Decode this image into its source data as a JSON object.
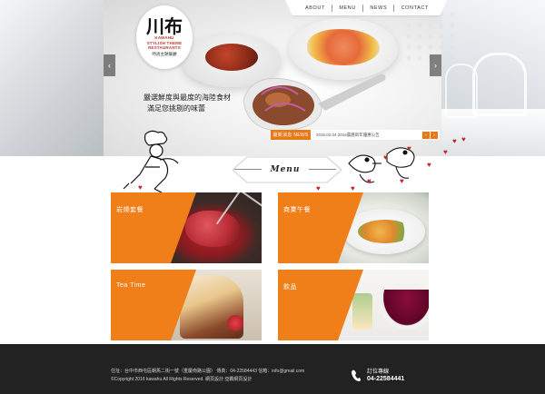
{
  "brand": {
    "logo_mark": "川布",
    "logo_line1": "KAWAHU",
    "logo_line2": "STYLISH THEME",
    "logo_line3": "RESTAURANTS",
    "logo_line4": "時尚主題餐廳"
  },
  "nav": {
    "items": [
      "ABOUT",
      "MENU",
      "NEWS",
      "CONTACT"
    ]
  },
  "hero": {
    "slogan_line1": "嚴選鮮度與最度的海陸食材",
    "slogan_line2": "滿足您挑剔的味蕾",
    "prev_arrow": "‹",
    "next_arrow": "›"
  },
  "news": {
    "tag": "最新消息 NEWS",
    "headline": "2016.02.04 2016農曆新年優惠公告",
    "prev": "‹",
    "next": "›"
  },
  "menu": {
    "title": "Menu",
    "tiles": [
      {
        "label": "岩燒套餐"
      },
      {
        "label": "商業午餐"
      },
      {
        "label": "Tea Time"
      },
      {
        "label": "飲品"
      }
    ]
  },
  "footer": {
    "address_line": "住址：台中市西屯區朝馬二街一號（重慶南路公園）  傳真：04-22584443  信箱：info@gmail.com",
    "copyright_line": "©Copyright 2016 kawahu All Rights Reserved. 網頁設計:亞霸網頁設計",
    "reserve_label": "訂位專線",
    "reserve_phone": "04-22584441"
  },
  "colors": {
    "accent": "#f07f1a",
    "footer_bg": "#222222",
    "heart": "#c0282f"
  }
}
